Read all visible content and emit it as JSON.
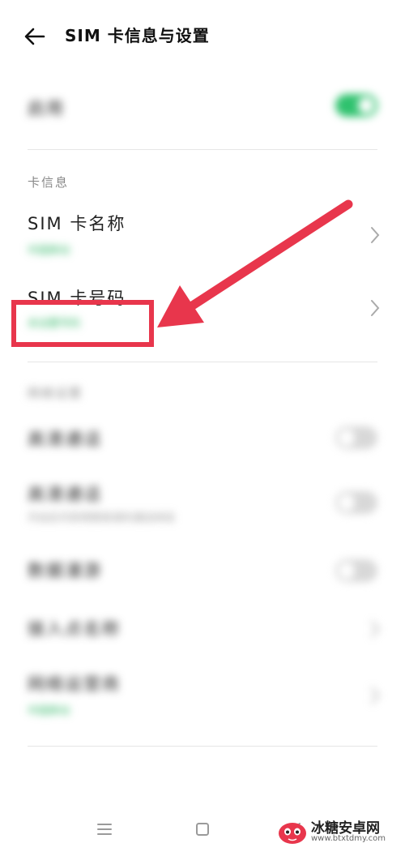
{
  "header": {
    "title": "SIM 卡信息与设置"
  },
  "enable_row": {
    "label": "启用",
    "toggle_on": true
  },
  "card_info": {
    "section_label": "卡信息",
    "sim_name": {
      "label": "SIM 卡名称",
      "value": "中国移动"
    },
    "sim_number": {
      "label": "SIM 卡号码",
      "value": "未设置号码"
    }
  },
  "network_section": {
    "section_label": "网络设置",
    "rows": [
      {
        "label": "高清通话",
        "toggle_on": false
      },
      {
        "label": "高清通话",
        "sub": "开启后可获得更高清的通话体验",
        "toggle_on": false
      },
      {
        "label": "数据漫游",
        "toggle_on": false
      },
      {
        "label": "接入点名称"
      },
      {
        "label": "网络运营商",
        "sub": "中国移动"
      }
    ]
  },
  "watermark": {
    "name": "冰糖安卓网",
    "url": "www.btxtdmy.com"
  },
  "colors": {
    "accent": "#2fc26e",
    "annotation": "#e8364c"
  }
}
